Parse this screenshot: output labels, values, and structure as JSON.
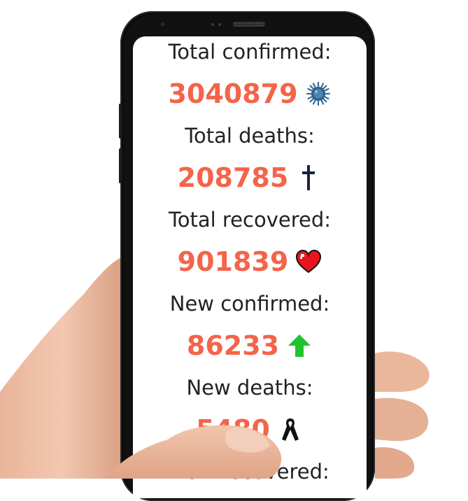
{
  "stats": [
    {
      "label": "Total confirmed:",
      "value": "3040879",
      "icon": "virus-icon"
    },
    {
      "label": "Total deaths:",
      "value": "208785",
      "icon": "cross-icon"
    },
    {
      "label": "Total recovered:",
      "value": "901839",
      "icon": "heart-icon"
    },
    {
      "label": "New confirmed:",
      "value": "86233",
      "icon": "up-arrow-icon"
    },
    {
      "label": "New deaths:",
      "value": "5480",
      "icon": "ribbon-icon"
    },
    {
      "label": "New recovered:",
      "value": "",
      "icon": ""
    }
  ],
  "colors": {
    "value": "#f4644a",
    "label": "#222222",
    "arrow": "#22c22e",
    "heart": "#e8141e",
    "cross": "#1a2440",
    "virus": "#3a6f99"
  }
}
